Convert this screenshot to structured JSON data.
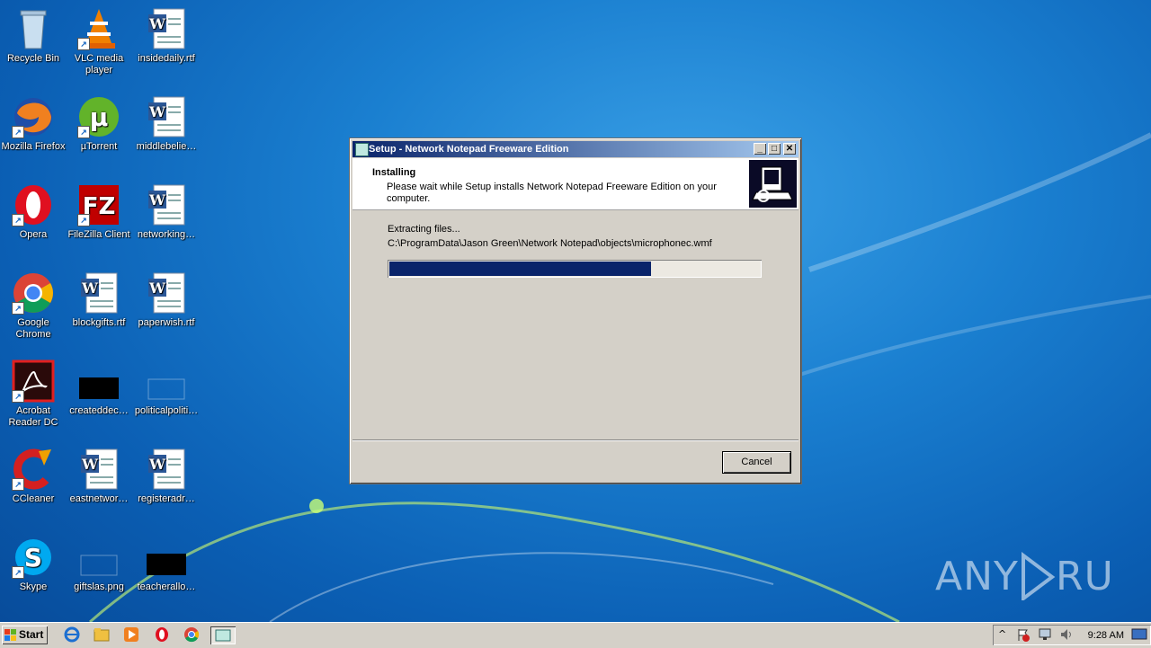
{
  "desktop": {
    "icons": [
      {
        "label": "Recycle Bin",
        "icon": "recycle-bin-icon"
      },
      {
        "label": "VLC media player",
        "icon": "vlc-icon"
      },
      {
        "label": "insidedaily.rtf",
        "icon": "word-document-icon"
      },
      {
        "label": "Mozilla Firefox",
        "icon": "firefox-icon"
      },
      {
        "label": "µTorrent",
        "icon": "utorrent-icon"
      },
      {
        "label": "middlebelie…",
        "icon": "word-document-icon"
      },
      {
        "label": "Opera",
        "icon": "opera-icon"
      },
      {
        "label": "FileZilla Client",
        "icon": "filezilla-icon"
      },
      {
        "label": "networking…",
        "icon": "word-document-icon"
      },
      {
        "label": "Google Chrome",
        "icon": "chrome-icon"
      },
      {
        "label": "blockgifts.rtf",
        "icon": "word-document-icon"
      },
      {
        "label": "paperwish.rtf",
        "icon": "word-document-icon"
      },
      {
        "label": "Acrobat Reader DC",
        "icon": "acrobat-icon"
      },
      {
        "label": "createddec…",
        "icon": "black-image-icon"
      },
      {
        "label": "politicalpoliti…",
        "icon": "blank-image-icon"
      },
      {
        "label": "CCleaner",
        "icon": "ccleaner-icon"
      },
      {
        "label": "eastnetwor…",
        "icon": "word-document-icon"
      },
      {
        "label": "registeradr…",
        "icon": "word-document-icon"
      },
      {
        "label": "Skype",
        "icon": "skype-icon"
      },
      {
        "label": "giftslas.png",
        "icon": "blank-image-icon"
      },
      {
        "label": "teacherallo…",
        "icon": "black-image-icon"
      }
    ]
  },
  "dialog": {
    "title": "Setup - Network Notepad Freeware Edition",
    "header_title": "Installing",
    "header_desc": "Please wait while Setup installs Network Notepad Freeware Edition on your computer.",
    "status": "Extracting files...",
    "current_file": "C:\\ProgramData\\Jason Green\\Network Notepad\\objects\\microphonec.wmf",
    "progress_percent": 71,
    "cancel_label": "Cancel"
  },
  "watermark": "ANY RUN",
  "taskbar": {
    "start_label": "Start",
    "clock": "9:28 AM"
  }
}
